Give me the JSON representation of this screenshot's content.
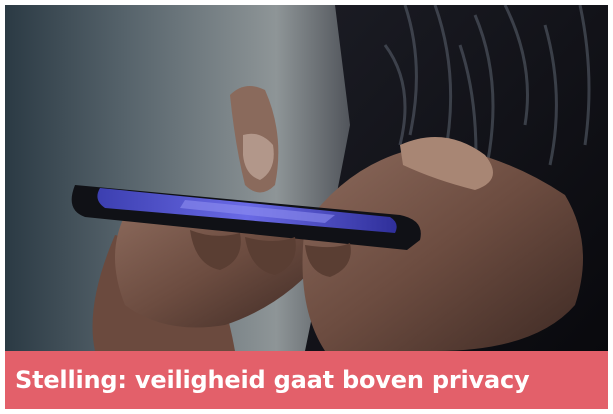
{
  "headline": {
    "text": "Stelling: veiligheid gaat boven privacy"
  },
  "image": {
    "subject": "hands-using-smartphone"
  },
  "colors": {
    "caption_background": "#e3606a",
    "caption_text": "#ffffff",
    "phone_screen": "#5a5ad8"
  }
}
